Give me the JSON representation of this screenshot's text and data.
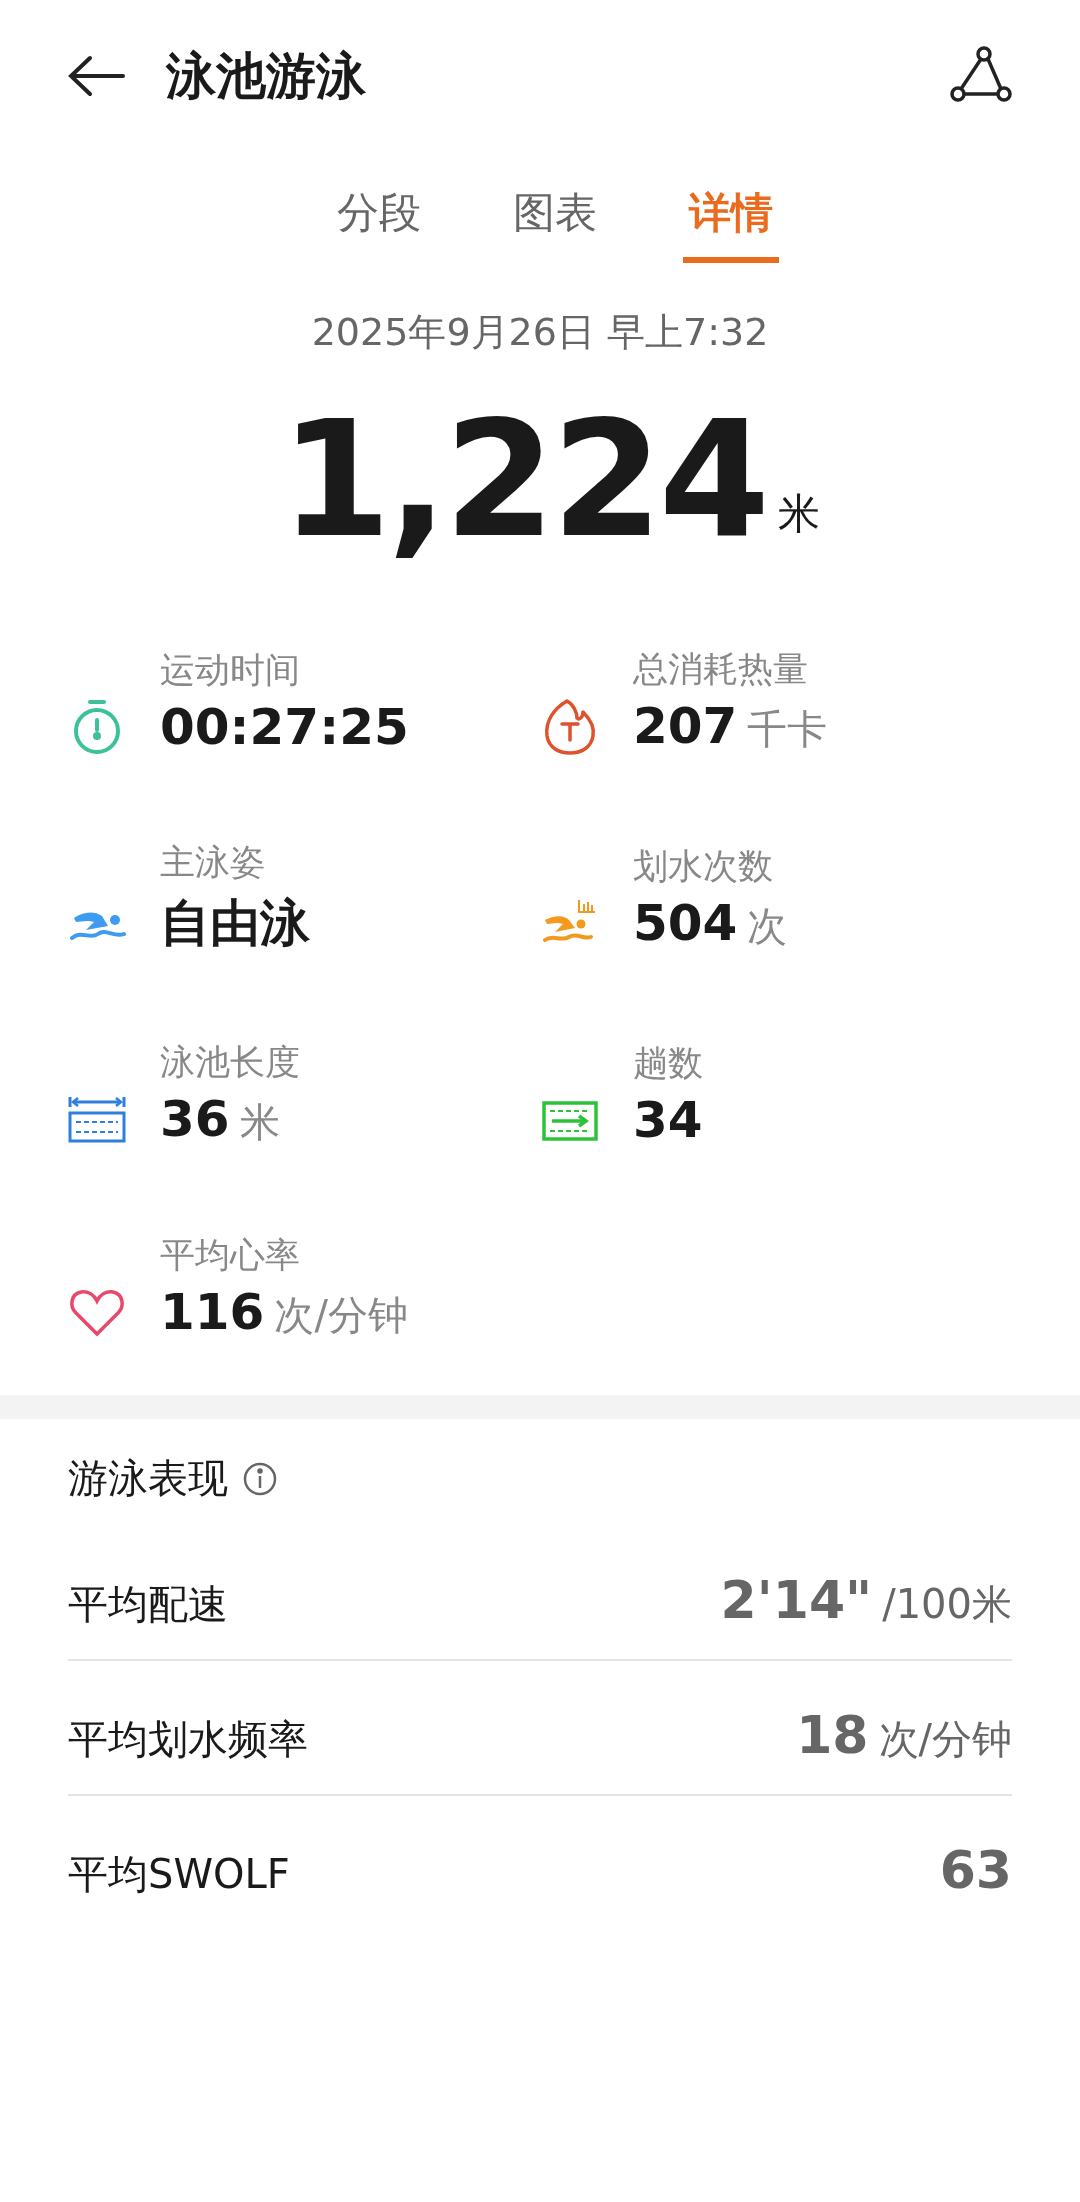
{
  "header": {
    "title": "泳池游泳"
  },
  "tabs": [
    {
      "label": "分段",
      "selected": false
    },
    {
      "label": "图表",
      "selected": false
    },
    {
      "label": "详情",
      "selected": true
    }
  ],
  "date": "2025年9月26日 早上7:32",
  "distance": {
    "value": "1,224",
    "unit": "米"
  },
  "stats": [
    {
      "kind": "duration",
      "label": "运动时间",
      "value": "00:27:25"
    },
    {
      "kind": "calories",
      "label": "总消耗热量",
      "value": "207",
      "unit": "千卡"
    },
    {
      "kind": "stroke",
      "label": "主泳姿",
      "value": "自由泳"
    },
    {
      "kind": "stroke_count",
      "label": "划水次数",
      "value": "504",
      "unit": "次"
    },
    {
      "kind": "pool_length",
      "label": "泳池长度",
      "value": "36",
      "unit": "米"
    },
    {
      "kind": "laps",
      "label": "趟数",
      "value": "34"
    },
    {
      "kind": "heart_rate",
      "label": "平均心率",
      "value": "116",
      "unit": "次/分钟"
    }
  ],
  "performance": {
    "title": "游泳表现",
    "rows": [
      {
        "label": "平均配速",
        "value": "2'14\"",
        "unit": "/100米"
      },
      {
        "label": "平均划水频率",
        "value": "18",
        "unit": "次/分钟"
      },
      {
        "label": "平均SWOLF",
        "value": "63"
      }
    ]
  }
}
